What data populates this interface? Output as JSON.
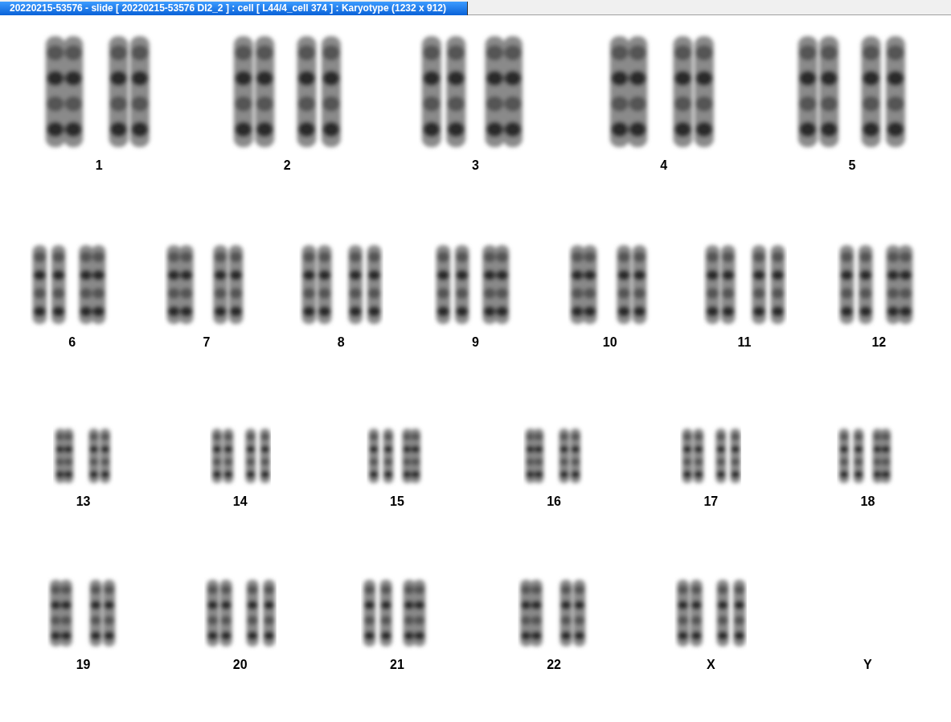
{
  "window": {
    "title": "20220215-53576 - slide [ 20220215-53576 DI2_2 ] : cell [ L44/4_cell 374 ] : Karyotype  (1232 x 912)"
  },
  "karyotype": {
    "rows": [
      {
        "pairs": [
          {
            "label": "1",
            "kind": "pair"
          },
          {
            "label": "2",
            "kind": "pair"
          },
          {
            "label": "3",
            "kind": "pair"
          },
          {
            "label": "4",
            "kind": "pair"
          },
          {
            "label": "5",
            "kind": "pair"
          }
        ]
      },
      {
        "pairs": [
          {
            "label": "6",
            "kind": "pair"
          },
          {
            "label": "7",
            "kind": "pair"
          },
          {
            "label": "8",
            "kind": "pair"
          },
          {
            "label": "9",
            "kind": "pair"
          },
          {
            "label": "10",
            "kind": "pair"
          },
          {
            "label": "11",
            "kind": "pair"
          },
          {
            "label": "12",
            "kind": "pair"
          }
        ]
      },
      {
        "pairs": [
          {
            "label": "13",
            "kind": "pair"
          },
          {
            "label": "14",
            "kind": "pair"
          },
          {
            "label": "15",
            "kind": "pair"
          },
          {
            "label": "16",
            "kind": "pair"
          },
          {
            "label": "17",
            "kind": "pair"
          },
          {
            "label": "18",
            "kind": "pair"
          }
        ]
      },
      {
        "pairs": [
          {
            "label": "19",
            "kind": "pair"
          },
          {
            "label": "20",
            "kind": "pair"
          },
          {
            "label": "21",
            "kind": "pair"
          },
          {
            "label": "22",
            "kind": "pair"
          },
          {
            "label": "X",
            "kind": "pair"
          },
          {
            "label": "Y",
            "kind": "empty"
          }
        ]
      }
    ]
  }
}
